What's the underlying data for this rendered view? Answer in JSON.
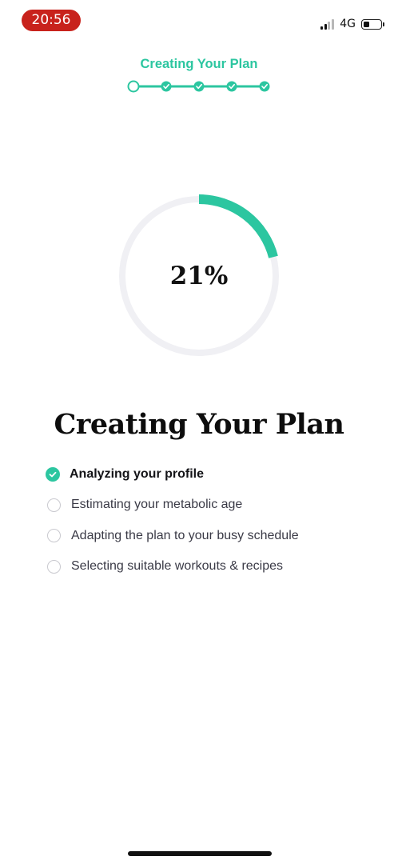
{
  "status_bar": {
    "time": "20:56",
    "network": "4G",
    "signal_bars_filled": 2,
    "signal_bars_total": 4,
    "battery_level": 0.35
  },
  "header": {
    "title": "Creating Your Plan",
    "steps_total": 5,
    "steps": [
      {
        "state": "current"
      },
      {
        "state": "done"
      },
      {
        "state": "done"
      },
      {
        "state": "done"
      },
      {
        "state": "done"
      }
    ]
  },
  "progress": {
    "value": 0.21,
    "label": "21%"
  },
  "main": {
    "title": "Creating Your Plan",
    "items": [
      {
        "label": "Analyzing your profile",
        "done": true
      },
      {
        "label": "Estimating your metabolic age",
        "done": false
      },
      {
        "label": "Adapting the plan to your busy schedule",
        "done": false
      },
      {
        "label": "Selecting suitable workouts & recipes",
        "done": false
      }
    ]
  },
  "colors": {
    "accent": "#2cc6a0",
    "track": "#f0f0f4",
    "status_pill": "#c8221c",
    "inactive_circle": "#c9c9cf"
  },
  "icons": {
    "done": "check-circle-icon",
    "pending": "empty-circle-icon"
  }
}
